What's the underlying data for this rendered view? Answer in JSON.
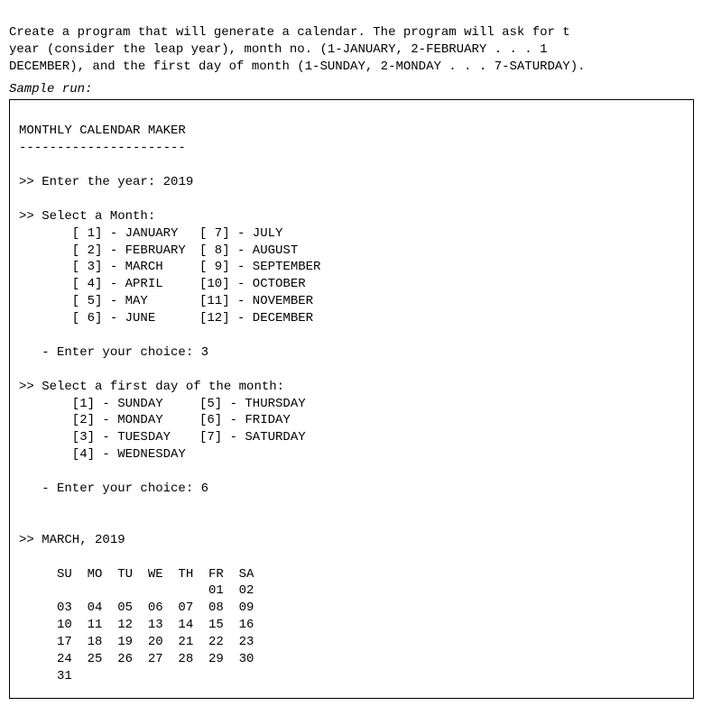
{
  "intro": {
    "line1": "Create a program that will generate a calendar. The program will ask for t",
    "line2": "year (consider the leap year), month no. (1-JANUARY, 2-FEBRUARY . . . 1",
    "line3": "DECEMBER), and the first day of month (1-SUNDAY, 2-MONDAY . . . 7-SATURDAY)."
  },
  "sample_label": "Sample run:",
  "header": {
    "title": "MONTHLY CALENDAR MAKER",
    "divider": "----------------------"
  },
  "prompts": {
    "year_label": ">> Enter the year: ",
    "year_value": "2019",
    "month_header": ">> Select a Month:",
    "months_left": [
      "       [ 1] - JANUARY",
      "       [ 2] - FEBRUARY",
      "       [ 3] - MARCH",
      "       [ 4] - APRIL",
      "       [ 5] - MAY",
      "       [ 6] - JUNE"
    ],
    "months_right": [
      "[ 7] - JULY",
      "[ 8] - AUGUST",
      "[ 9] - SEPTEMBER",
      "[10] - OCTOBER",
      "[11] - NOVEMBER",
      "[12] - DECEMBER"
    ],
    "month_choice_label": "   - Enter your choice: ",
    "month_choice_value": "3",
    "day_header": ">> Select a first day of the month:",
    "days_left": [
      "       [1] - SUNDAY",
      "       [2] - MONDAY",
      "       [3] - TUESDAY",
      "       [4] - WEDNESDAY"
    ],
    "days_right": [
      "[5] - THURSDAY",
      "[6] - FRIDAY",
      "[7] - SATURDAY",
      ""
    ],
    "day_choice_label": "   - Enter your choice: ",
    "day_choice_value": "6"
  },
  "calendar": {
    "title": ">> MARCH, 2019",
    "header_row": "     SU  MO  TU  WE  TH  FR  SA",
    "rows": [
      "                         01  02",
      "     03  04  05  06  07  08  09",
      "     10  11  12  13  14  15  16",
      "     17  18  19  20  21  22  23",
      "     24  25  26  27  28  29  30",
      "     31"
    ]
  },
  "chart_data": {
    "type": "table",
    "title": "MARCH, 2019",
    "year": 2019,
    "month": 3,
    "month_name": "MARCH",
    "first_day_index": 6,
    "first_day_name": "FRIDAY",
    "days_in_month": 31,
    "weekday_headers": [
      "SU",
      "MO",
      "TU",
      "WE",
      "TH",
      "FR",
      "SA"
    ],
    "grid": [
      [
        null,
        null,
        null,
        null,
        null,
        1,
        2
      ],
      [
        3,
        4,
        5,
        6,
        7,
        8,
        9
      ],
      [
        10,
        11,
        12,
        13,
        14,
        15,
        16
      ],
      [
        17,
        18,
        19,
        20,
        21,
        22,
        23
      ],
      [
        24,
        25,
        26,
        27,
        28,
        29,
        30
      ],
      [
        31,
        null,
        null,
        null,
        null,
        null,
        null
      ]
    ]
  }
}
